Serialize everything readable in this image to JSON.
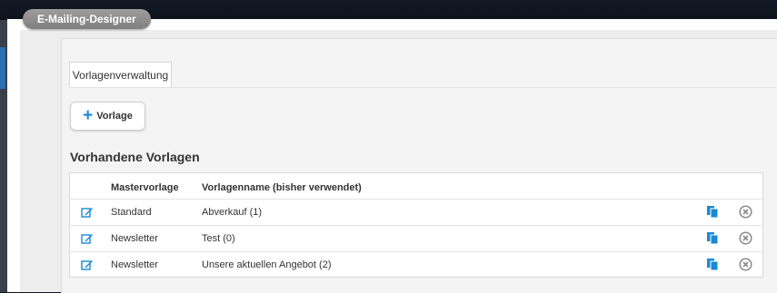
{
  "window": {
    "title": "E-Mailing-Designer"
  },
  "tabs": [
    {
      "label": "Vorlagenverwaltung"
    }
  ],
  "toolbar": {
    "add_label": "Vorlage"
  },
  "section": {
    "title": "Vorhandene Vorlagen"
  },
  "table": {
    "headers": [
      "Mastervorlage",
      "Vorlagenname (bisher verwendet)"
    ],
    "rows": [
      {
        "master": "Standard",
        "name": "Abverkauf (1)"
      },
      {
        "master": "Newsletter",
        "name": "Test (0)"
      },
      {
        "master": "Newsletter",
        "name": "Unsere aktuellen Angebot (2)"
      }
    ]
  },
  "colors": {
    "accent": "#1a8ad4",
    "title_pill": "#8c8c8c",
    "delete_icon": "#8a8a8a"
  },
  "icons": {
    "edit": "edit-icon",
    "copy": "copy-icon",
    "delete": "delete-icon",
    "add": "plus-icon"
  }
}
